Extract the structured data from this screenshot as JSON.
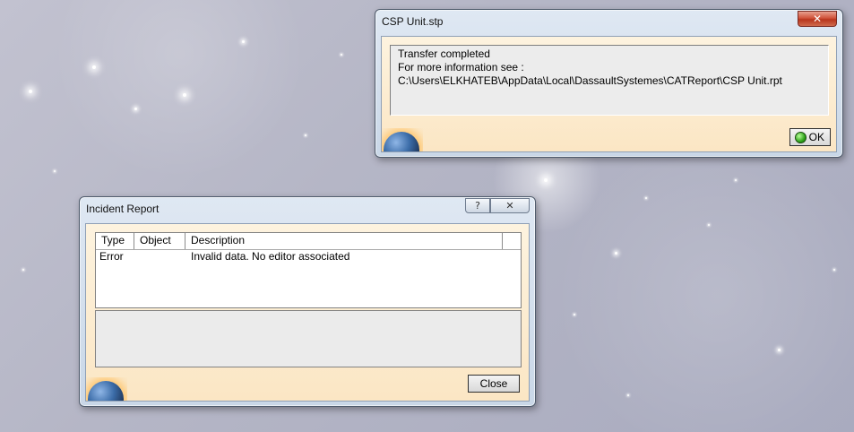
{
  "csp_dialog": {
    "title": "CSP Unit.stp",
    "close_glyph": "✕",
    "message_lines": [
      "Transfer completed",
      "For more information see :",
      "C:\\Users\\ELKHATEB\\AppData\\Local\\DassaultSystemes\\CATReport\\CSP Unit.rpt"
    ],
    "ok_label": "OK"
  },
  "incident_report": {
    "title": "Incident Report",
    "help_glyph": "?",
    "close_glyph": "✕",
    "columns": [
      "Type",
      "Object",
      "Description"
    ],
    "rows": [
      {
        "type": "Error",
        "object": "",
        "description": "Invalid data. No editor associated"
      }
    ],
    "close_label": "Close"
  },
  "colors": {
    "client_bg": "#fbe6c4",
    "frame": "#c9d7e7",
    "close_red": "#d0533b"
  },
  "icons": [
    "close-icon",
    "help-icon",
    "ok-check-icon",
    "globe-logo-icon"
  ]
}
